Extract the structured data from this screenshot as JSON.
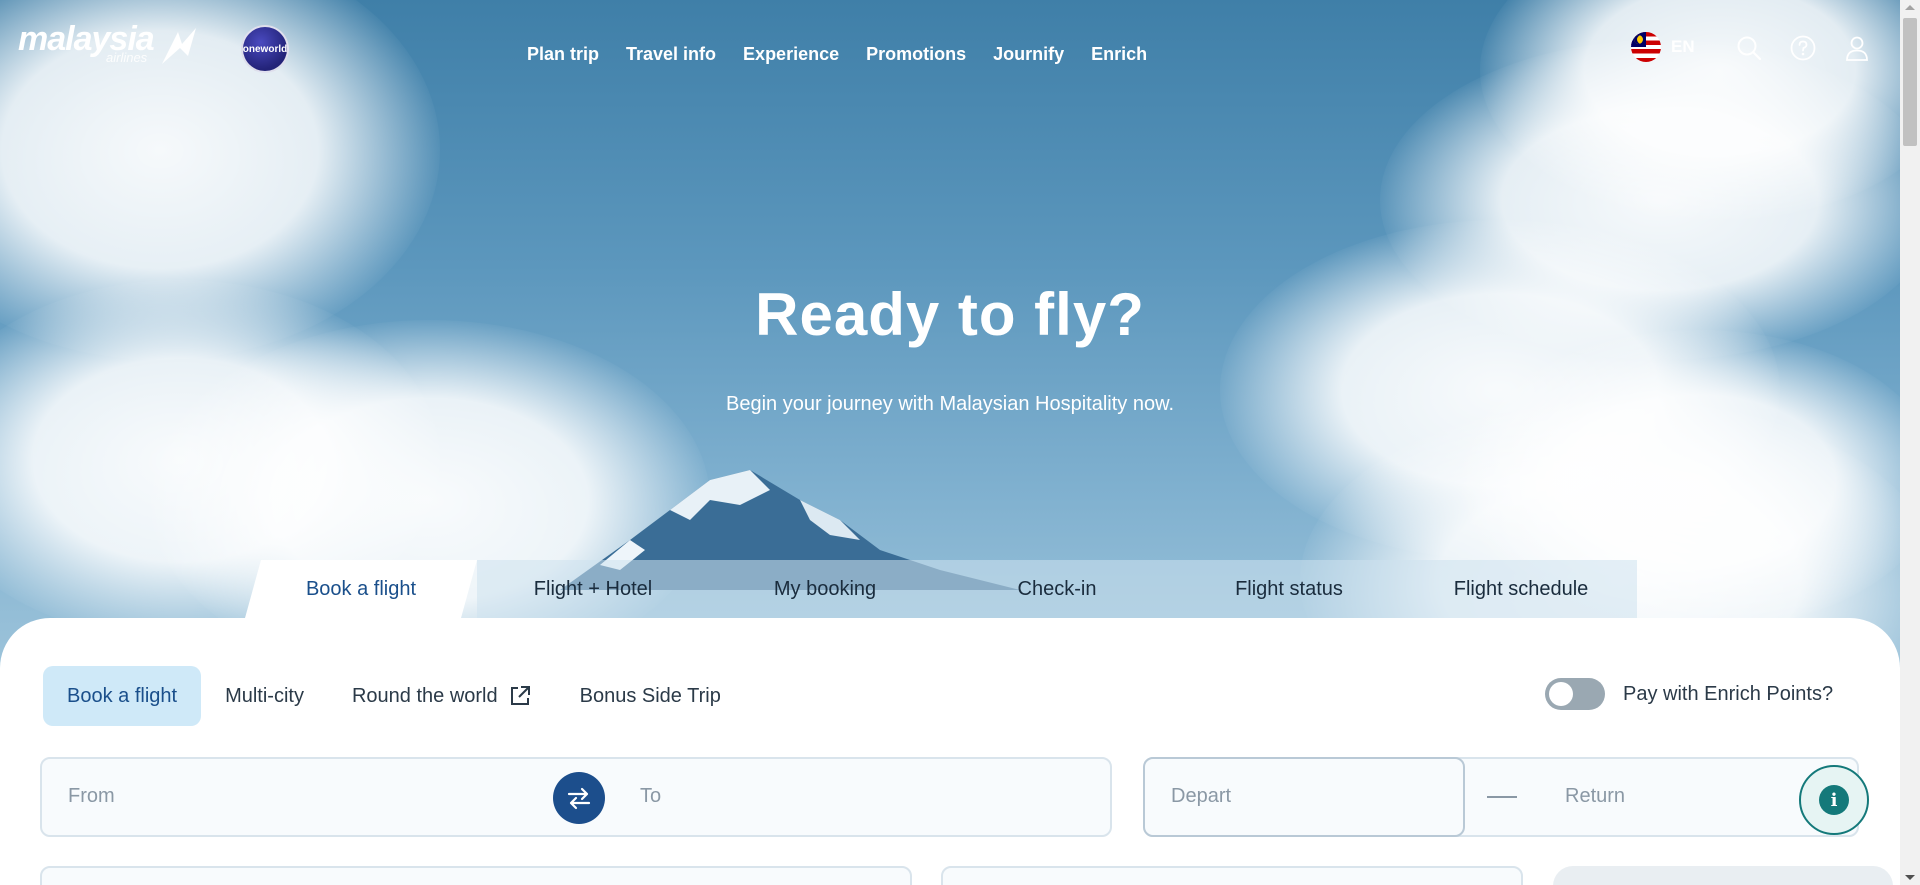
{
  "brand": {
    "logo_text": "malaysia",
    "logo_sub": "airlines",
    "alliance": "oneworld"
  },
  "nav": {
    "items": [
      "Plan trip",
      "Travel info",
      "Experience",
      "Promotions",
      "Journify",
      "Enrich"
    ]
  },
  "header": {
    "language": "EN",
    "icons": [
      "malaysia-flag-icon",
      "search-icon",
      "help-icon",
      "user-icon"
    ]
  },
  "hero": {
    "title": "Ready to fly?",
    "subtitle": "Begin your journey with Malaysian Hospitality now."
  },
  "main_tabs": [
    {
      "label": "Book a flight",
      "active": true
    },
    {
      "label": "Flight + Hotel",
      "active": false
    },
    {
      "label": "My booking",
      "active": false
    },
    {
      "label": "Check-in",
      "active": false
    },
    {
      "label": "Flight status",
      "active": false
    },
    {
      "label": "Flight schedule",
      "active": false
    }
  ],
  "sub_tabs": [
    {
      "label": "Book a flight",
      "active": true
    },
    {
      "label": "Multi-city",
      "active": false
    },
    {
      "label": "Round the world",
      "active": false,
      "icon": "external-link-icon"
    },
    {
      "label": "Bonus Side Trip",
      "active": false
    }
  ],
  "enrich_toggle": {
    "label": "Pay with Enrich Points?",
    "checked": false
  },
  "form": {
    "from_placeholder": "From",
    "to_placeholder": "To",
    "depart_placeholder": "Depart",
    "return_placeholder": "Return"
  },
  "colors": {
    "primary": "#1c4e8c",
    "active_subtab_bg": "#cfe9f8",
    "info_teal": "#14797a"
  }
}
